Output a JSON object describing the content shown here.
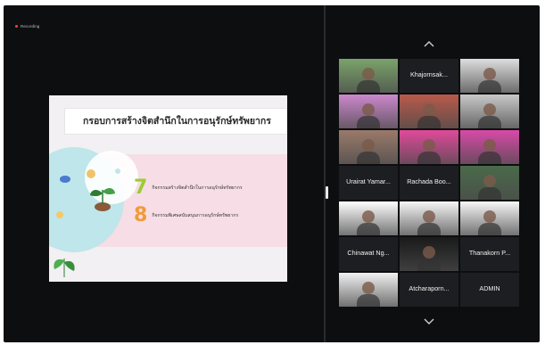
{
  "recording": {
    "label": "Recording"
  },
  "slide": {
    "title": "กรอบการสร้างจิตสำนึกในการอนุรักษ์ทรัพยากร",
    "items": [
      {
        "number": "7",
        "text": "กิจกรรมสร้างจิตสำนึกในการอนุรักษ์ทรัพยากร"
      },
      {
        "number": "8",
        "text": "กิจกรรมพิเศษสนับสนุนการอนุรักษ์ทรัพยากร"
      }
    ]
  },
  "gallery": {
    "scroll_up_icon": "chevron-up-icon",
    "scroll_down_icon": "chevron-down-icon",
    "tiles": [
      {
        "label": "",
        "kind": "video",
        "tone": "#7aa36a"
      },
      {
        "label": "Khajornsak...",
        "kind": "name"
      },
      {
        "label": "",
        "kind": "video",
        "tone": "#dddddd"
      },
      {
        "label": "",
        "kind": "video",
        "tone": "#cc88cc"
      },
      {
        "label": "",
        "kind": "video",
        "tone": "#b85a4a"
      },
      {
        "label": "",
        "kind": "video",
        "tone": "#c8c8c8"
      },
      {
        "label": "",
        "kind": "video",
        "tone": "#9a7a6a"
      },
      {
        "label": "",
        "kind": "video",
        "tone": "#e04a9a"
      },
      {
        "label": "",
        "kind": "video",
        "tone": "#d84aa8"
      },
      {
        "label": "Urairat Yamar...",
        "kind": "name"
      },
      {
        "label": "Rachada Boo...",
        "kind": "name"
      },
      {
        "label": "",
        "kind": "video",
        "tone": "#4a6a4a"
      },
      {
        "label": "",
        "kind": "video",
        "tone": "#ffffff"
      },
      {
        "label": "",
        "kind": "video",
        "tone": "#f5f5f5"
      },
      {
        "label": "",
        "kind": "video",
        "tone": "#f7f7f7"
      },
      {
        "label": "Chinawat Ng...",
        "kind": "name"
      },
      {
        "label": "",
        "kind": "video",
        "tone": "#1a1a1a"
      },
      {
        "label": "Thanakorn P...",
        "kind": "name"
      },
      {
        "label": "",
        "kind": "video",
        "tone": "#f0f0f0"
      },
      {
        "label": "Atcharaporn...",
        "kind": "name"
      },
      {
        "label": "ADMIN",
        "kind": "name"
      }
    ]
  }
}
